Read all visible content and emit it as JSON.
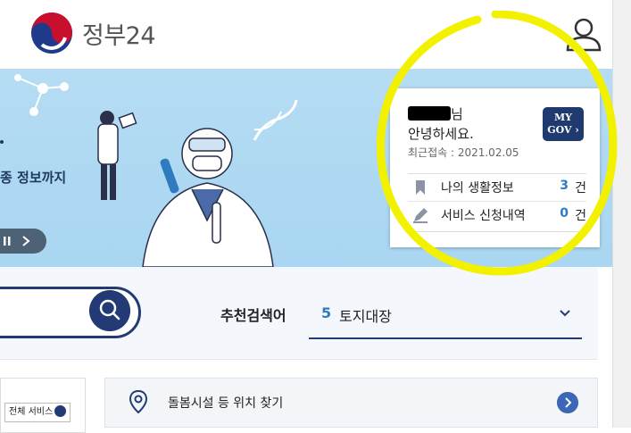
{
  "header": {
    "logo_text": "정부24"
  },
  "banner": {
    "tagline": "종 정보까지"
  },
  "my_panel": {
    "name_suffix": "님",
    "greeting": "안녕하세요.",
    "last_login": "최근접속 : 2021.02.05",
    "mygov_line1": "MY",
    "mygov_line2": "GOV",
    "rows": [
      {
        "label": "나의 생활정보",
        "count": "3",
        "unit": "건",
        "icon": "bookmark-icon"
      },
      {
        "label": "서비스 신청내역",
        "count": "0",
        "unit": "건",
        "icon": "pencil-icon"
      }
    ]
  },
  "search": {
    "recommended_label": "추천검색어",
    "recommended_rank": "5",
    "recommended_term": "토지대장"
  },
  "lower": {
    "all_services": "전체 서비스",
    "care_item": "돌봄시설 등 위치 찾기"
  },
  "colors": {
    "primary": "#233a75",
    "accent": "#2e7bbf",
    "banner_bg": "#b5dcf3",
    "highlight": "#f2f200"
  }
}
